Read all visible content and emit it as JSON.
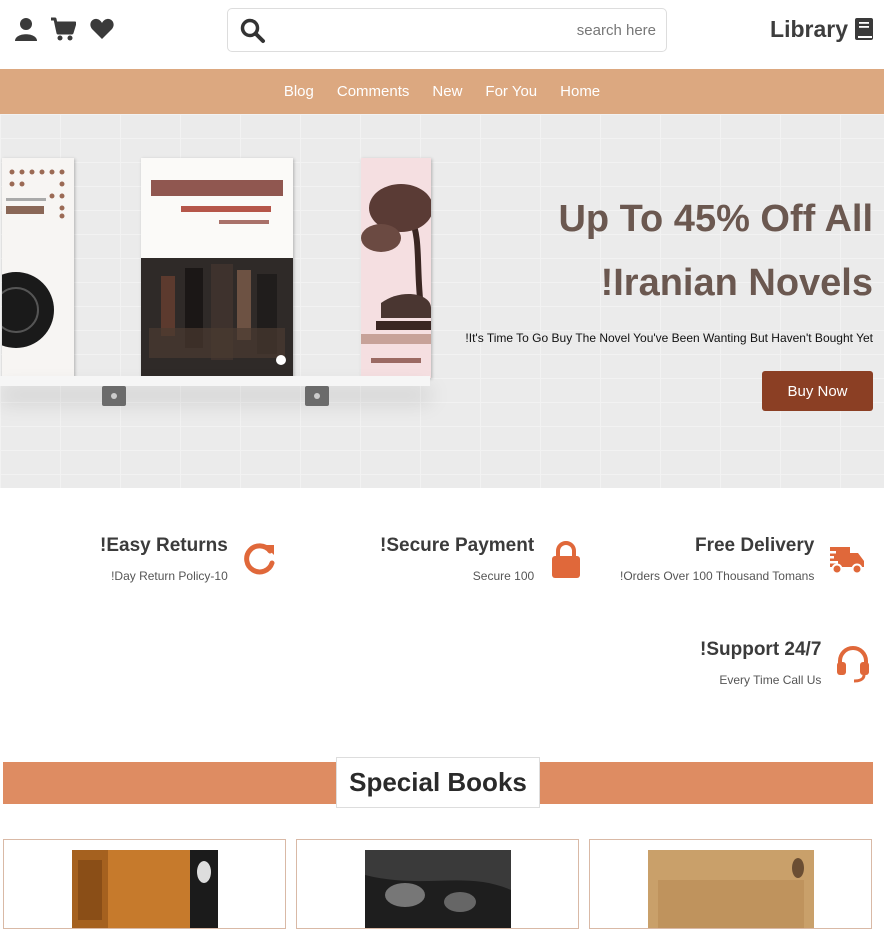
{
  "header": {
    "search": {
      "placeholder": "search here",
      "value": ""
    },
    "logo_text": "Library",
    "icons": [
      "user-icon",
      "cart-icon",
      "heart-icon",
      "book-icon",
      "search-icon"
    ]
  },
  "nav": {
    "items": [
      "Blog",
      "Comments",
      "New",
      "For You",
      "Home"
    ]
  },
  "hero": {
    "title_line1": "Up To 45% Off All",
    "title_line2": "!Iranian Novels",
    "subtitle": "!It's Time To Go Buy The Novel You've Been Wanting But Haven't Bought Yet",
    "buy_label": "Buy Now"
  },
  "features": [
    {
      "title": "!Easy Returns",
      "desc": "!Day Return Policy-10",
      "icon": "refresh-icon"
    },
    {
      "title": "!Secure Payment",
      "desc": "Secure 100",
      "icon": "lock-icon"
    },
    {
      "title": "Free Delivery",
      "desc": "!Orders Over 100 Thousand Tomans",
      "icon": "truck-icon"
    },
    {
      "title": "!Support 24/7",
      "desc": "Every Time Call Us",
      "icon": "headset-icon"
    }
  ],
  "special": {
    "title": "Special Books"
  },
  "colors": {
    "nav": "#dca880",
    "accent": "#e0683a",
    "button": "#8b3f24",
    "special_bar": "#de8c62",
    "title": "#6b5850"
  }
}
